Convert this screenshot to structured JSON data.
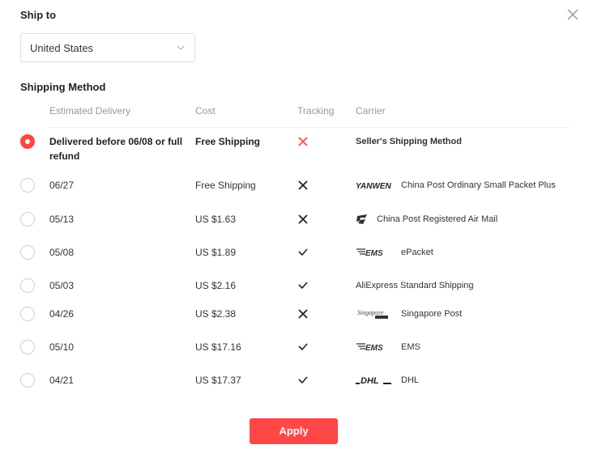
{
  "header": {
    "ship_to_label": "Ship to",
    "close_icon": "close-icon"
  },
  "country_select": {
    "value": "United States",
    "icon": "chevron-down-icon"
  },
  "shipping": {
    "title": "Shipping Method",
    "columns": {
      "delivery": "Estimated Delivery",
      "cost": "Cost",
      "tracking": "Tracking",
      "carrier": "Carrier"
    },
    "rows": [
      {
        "selected": true,
        "delivery": "Delivered before 06/08 or full refund",
        "cost": "Free Shipping",
        "tracking": "no",
        "tracking_color": "#ff4747",
        "carrier_logo": "",
        "carrier": "Seller's Shipping Method",
        "bold": true
      },
      {
        "selected": false,
        "delivery": "06/27",
        "cost": "Free Shipping",
        "tracking": "no",
        "tracking_color": "#222222",
        "carrier_logo": "yanwen-logo",
        "carrier": "China Post Ordinary Small Packet Plus",
        "bold": false
      },
      {
        "selected": false,
        "delivery": "05/13",
        "cost": "US $1.63",
        "tracking": "no",
        "tracking_color": "#222222",
        "carrier_logo": "china-post-logo",
        "carrier": "China Post Registered Air Mail",
        "bold": false
      },
      {
        "selected": false,
        "delivery": "05/08",
        "cost": "US $1.89",
        "tracking": "yes",
        "tracking_color": "#222222",
        "carrier_logo": "ems-logo",
        "carrier": "ePacket",
        "bold": false
      },
      {
        "selected": false,
        "delivery": "05/03",
        "cost": "US $2.16",
        "tracking": "yes",
        "tracking_color": "#222222",
        "carrier_logo": "",
        "carrier": "AliExpress Standard Shipping",
        "bold": false
      },
      {
        "selected": false,
        "delivery": "04/26",
        "cost": "US $2.38",
        "tracking": "no",
        "tracking_color": "#222222",
        "carrier_logo": "singapore-post-logo",
        "carrier": "Singapore Post",
        "bold": false
      },
      {
        "selected": false,
        "delivery": "05/10",
        "cost": "US $17.16",
        "tracking": "yes",
        "tracking_color": "#222222",
        "carrier_logo": "ems-logo",
        "carrier": "EMS",
        "bold": false
      },
      {
        "selected": false,
        "delivery": "04/21",
        "cost": "US $17.37",
        "tracking": "yes",
        "tracking_color": "#222222",
        "carrier_logo": "dhl-logo",
        "carrier": "DHL",
        "bold": false
      }
    ]
  },
  "apply_button": {
    "label": "Apply",
    "color": "#ff4747"
  }
}
